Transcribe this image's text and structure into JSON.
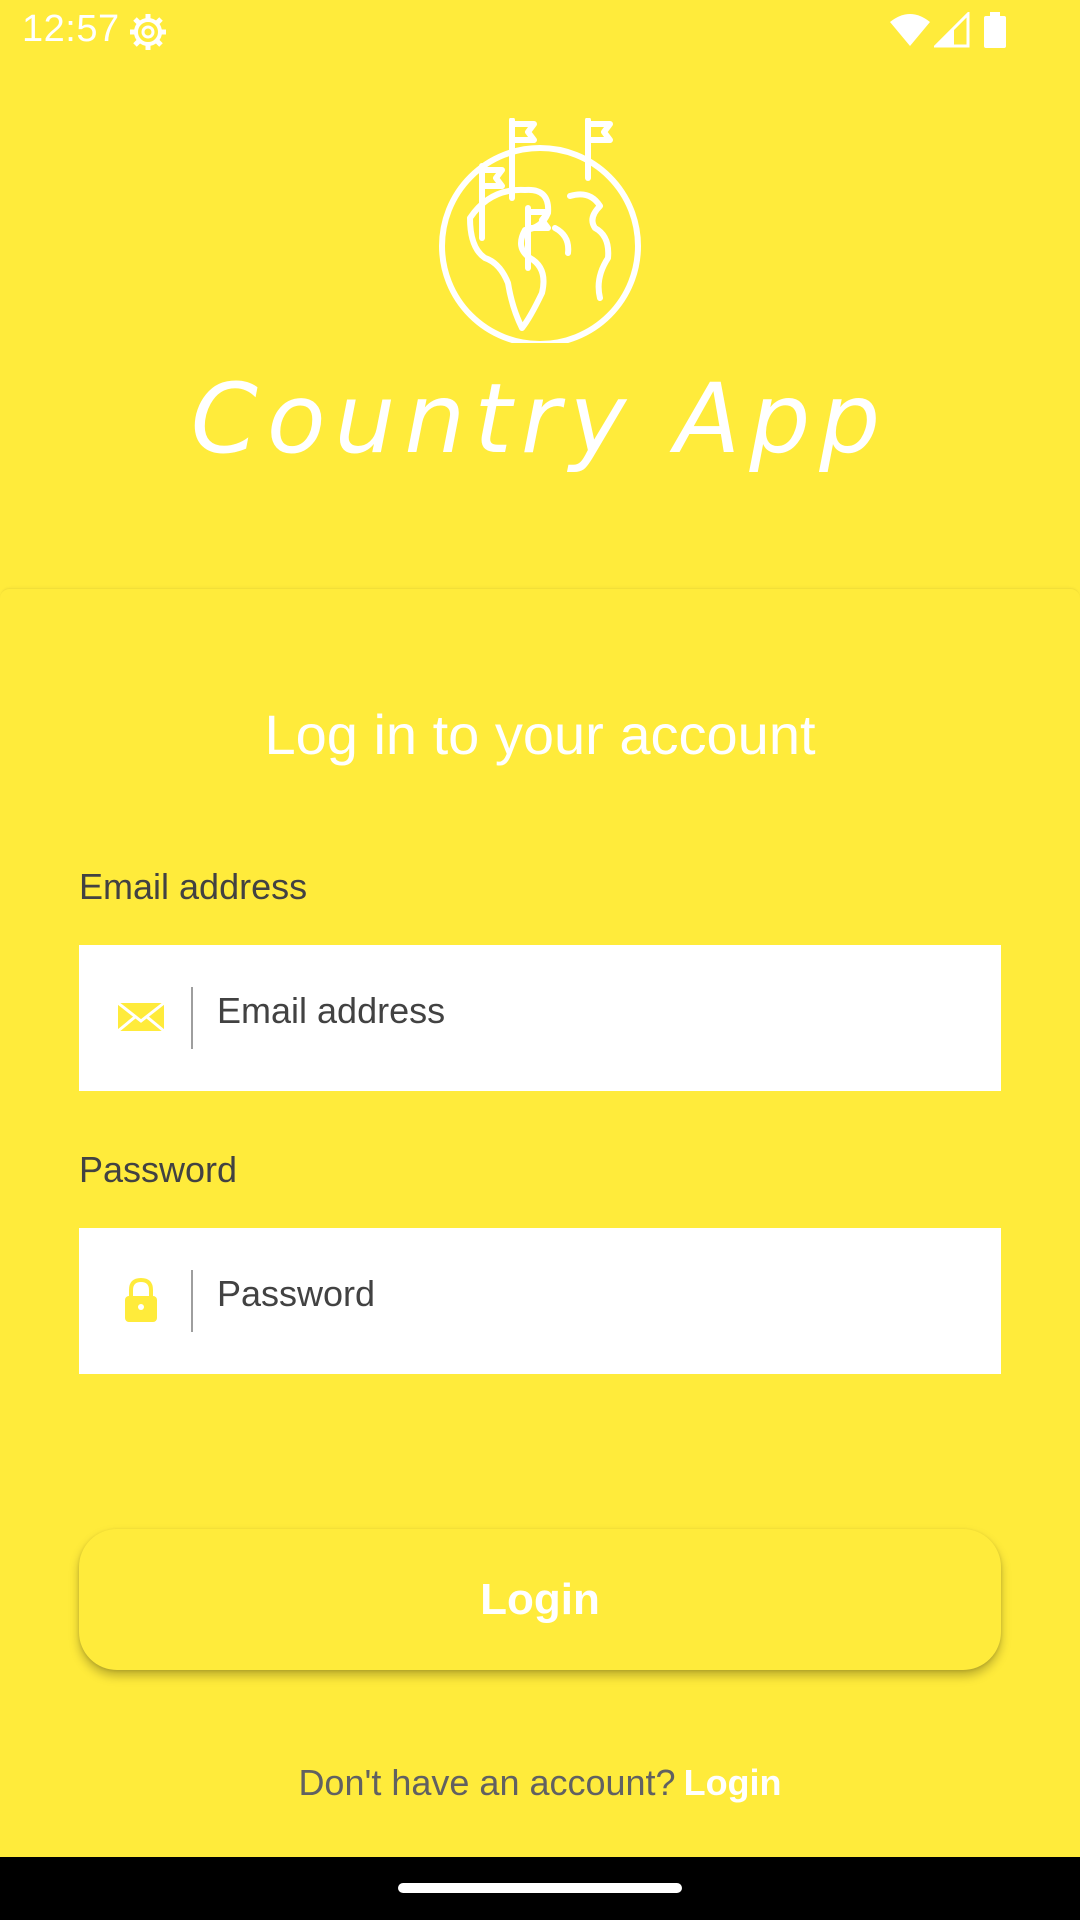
{
  "status_bar": {
    "time": "12:57",
    "icons": [
      "settings-icon",
      "wifi-icon",
      "signal-icon",
      "battery-icon"
    ]
  },
  "header": {
    "logo": "globe-with-flags-icon",
    "app_title": "Country App"
  },
  "form": {
    "title": "Log in to your account",
    "email": {
      "label": "Email address",
      "placeholder": "Email address",
      "value": "",
      "icon": "envelope-icon"
    },
    "password": {
      "label": "Password",
      "placeholder": "Password",
      "value": "",
      "icon": "lock-icon"
    },
    "login_button": "Login"
  },
  "footer": {
    "prompt": "Don't have an account?",
    "link": "Login"
  },
  "colors": {
    "background": "#FFEB3B",
    "text_dark": "#424242",
    "white": "#FFFFFF"
  }
}
